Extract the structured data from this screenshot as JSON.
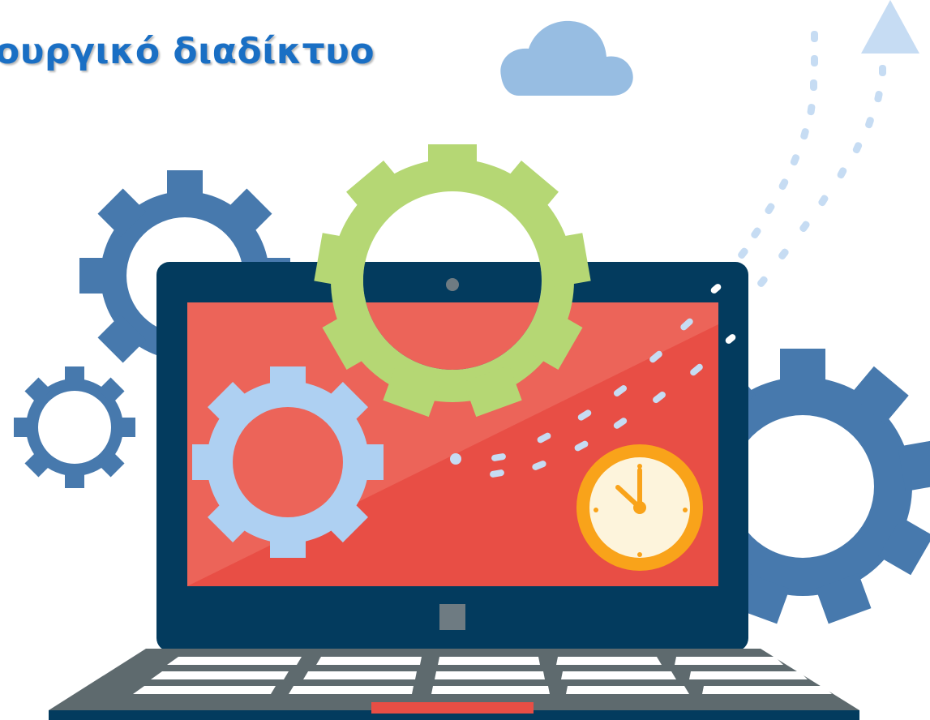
{
  "header": {
    "title": "ουργικό διαδίκτυο"
  },
  "illustration": {
    "icons": [
      "cloud-icon",
      "gear-icon",
      "laptop-icon",
      "clock-icon",
      "arrow-up-icon"
    ],
    "colors": {
      "title": "#1a6fc4",
      "gear_dark": "#4779ad",
      "gear_light": "#aed0f2",
      "gear_green": "#b5d774",
      "screen_red": "#e84e45",
      "screen_highlight": "#ec6459",
      "laptop_frame": "#033b5e",
      "keyboard": "#5e6a6e",
      "clock_ring": "#f9a31a",
      "clock_face": "#fdf4dc",
      "cloud": "#97bde2"
    }
  }
}
